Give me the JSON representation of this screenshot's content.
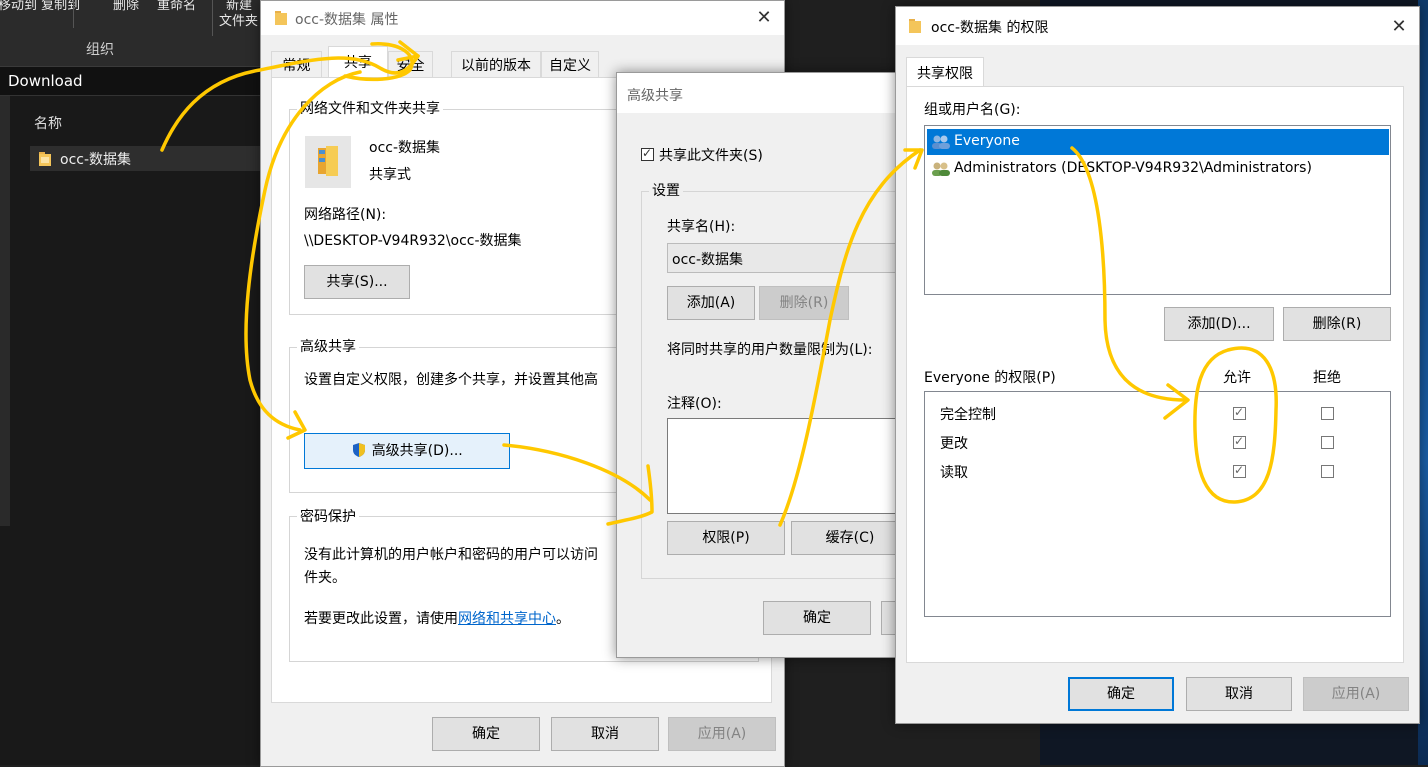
{
  "explorer": {
    "ribbon": {
      "btn_move": "移动到 复制到",
      "btn_delete": "删除",
      "btn_rename": "重命名",
      "btn_new": "新建",
      "btn_new2": "文件夹",
      "group": "组织"
    },
    "address": "Download",
    "column_name": "名称",
    "file_name": "occ-数据集"
  },
  "properties": {
    "title": "occ-数据集 属性",
    "tabs": [
      "常规",
      "共享",
      "安全",
      "以前的版本",
      "自定义"
    ],
    "network_group_title": "网络文件和文件夹共享",
    "folder_name": "occ-数据集",
    "share_state": "共享式",
    "net_path_label": "网络路径(N):",
    "net_path": "\\\\DESKTOP-V94R932\\occ-数据集",
    "share_button": "共享(S)...",
    "advanced_group_title": "高级共享",
    "advanced_desc": "设置自定义权限，创建多个共享，并设置其他高",
    "advanced_button": "高级共享(D)...",
    "password_group_title": "密码保护",
    "password_desc1": "没有此计算机的用户帐户和密码的用户可以访问",
    "password_desc2": "件夹。",
    "password_change_prefix": "若要更改此设置，请使用",
    "password_change_link": "网络和共享中心",
    "password_change_suffix": "。",
    "ok": "确定",
    "cancel": "取消",
    "apply": "应用(A)"
  },
  "advanced": {
    "title": "高级共享",
    "share_checkbox_label": "共享此文件夹(S)",
    "settings_group": "设置",
    "share_name_label": "共享名(H):",
    "share_name_value": "occ-数据集",
    "add": "添加(A)",
    "remove": "删除(R)",
    "limit_label": "将同时共享的用户数量限制为(L):",
    "comment_label": "注释(O):",
    "permissions": "权限(P)",
    "cache": "缓存(C)",
    "ok": "确定"
  },
  "perm": {
    "title": "occ-数据集 的权限",
    "tab": "共享权限",
    "groups_label": "组或用户名(G):",
    "users": [
      "Everyone",
      "Administrators (DESKTOP-V94R932\\Administrators)"
    ],
    "add": "添加(D)...",
    "remove": "删除(R)",
    "perm_label": "Everyone 的权限(P)",
    "allow": "允许",
    "deny": "拒绝",
    "rows": [
      {
        "name": "完全控制",
        "allow": true,
        "deny": false
      },
      {
        "name": "更改",
        "allow": true,
        "deny": false
      },
      {
        "name": "读取",
        "allow": true,
        "deny": false
      }
    ],
    "ok": "确定",
    "cancel": "取消",
    "apply": "应用(A)"
  },
  "colors": {
    "annotation": "#ffc800",
    "selection": "#0078d7",
    "link": "#0066cc"
  }
}
